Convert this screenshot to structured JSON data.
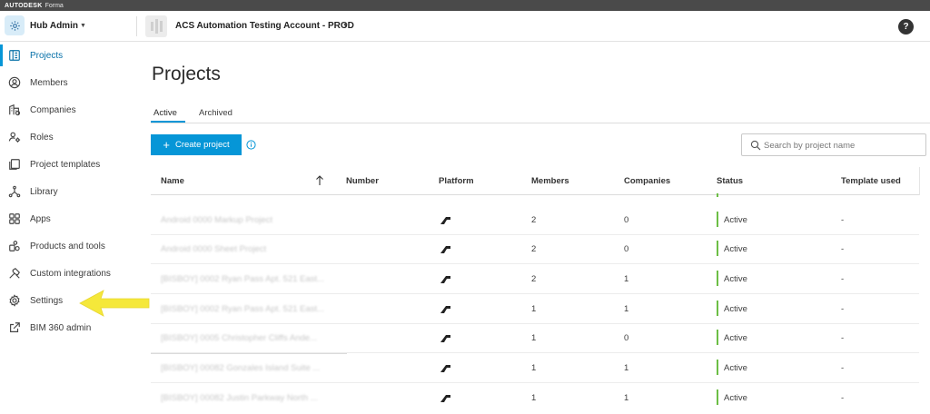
{
  "brand": {
    "name": "AUTODESK",
    "product": "Forma"
  },
  "topbar": {
    "hub_title": "Hub Admin",
    "account_title": "ACS Automation Testing Account - PROD",
    "help_label": "?"
  },
  "sidebar": {
    "items": [
      {
        "label": "Projects",
        "icon": "projects-icon",
        "active": true
      },
      {
        "label": "Members",
        "icon": "user-circle-icon"
      },
      {
        "label": "Companies",
        "icon": "companies-icon"
      },
      {
        "label": "Roles",
        "icon": "roles-icon"
      },
      {
        "label": "Project templates",
        "icon": "templates-icon"
      },
      {
        "label": "Library",
        "icon": "library-icon"
      },
      {
        "label": "Apps",
        "icon": "apps-grid-icon"
      },
      {
        "label": "Products and tools",
        "icon": "products-icon"
      },
      {
        "label": "Custom integrations",
        "icon": "integrations-icon"
      },
      {
        "label": "Settings",
        "icon": "gear-icon"
      },
      {
        "label": "BIM 360 admin",
        "icon": "external-link-icon"
      }
    ]
  },
  "main": {
    "title": "Projects",
    "tabs": [
      {
        "label": "Active",
        "active": true
      },
      {
        "label": "Archived"
      }
    ],
    "create_button_label": "Create project",
    "search_placeholder": "Search by project name"
  },
  "table": {
    "columns": [
      "Name",
      "Number",
      "Platform",
      "Members",
      "Companies",
      "Status",
      "Template used"
    ],
    "rows": [
      {
        "name": "Android 0000 Markup Project",
        "number": "",
        "members": "2",
        "companies": "0",
        "status": "Active",
        "template": "-"
      },
      {
        "name": "Android 0000 Sheet Project",
        "number": "",
        "members": "2",
        "companies": "0",
        "status": "Active",
        "template": "-"
      },
      {
        "name": "[BISBOY] 0002 Ryan Pass Apt. 521 East...",
        "number": "",
        "members": "2",
        "companies": "1",
        "status": "Active",
        "template": "-"
      },
      {
        "name": "[BISBOY] 0002 Ryan Pass Apt. 521 East...",
        "number": "",
        "members": "1",
        "companies": "1",
        "status": "Active",
        "template": "-"
      },
      {
        "name": "[BISBOY] 0005 Christopher Cliffs Ande...",
        "number": "",
        "members": "1",
        "companies": "0",
        "status": "Active",
        "template": "-"
      },
      {
        "name": "[BISBOY] 00082 Gonzales Island Suite ...",
        "number": "",
        "members": "1",
        "companies": "1",
        "status": "Active",
        "template": "-"
      },
      {
        "name": "[BISBOY] 00082 Justin Parkway North ...",
        "number": "",
        "members": "1",
        "companies": "1",
        "status": "Active",
        "template": "-"
      }
    ]
  },
  "colors": {
    "accent": "#0696d7",
    "status_active": "#6cbe45",
    "annotation_arrow": "#f5e83a"
  }
}
